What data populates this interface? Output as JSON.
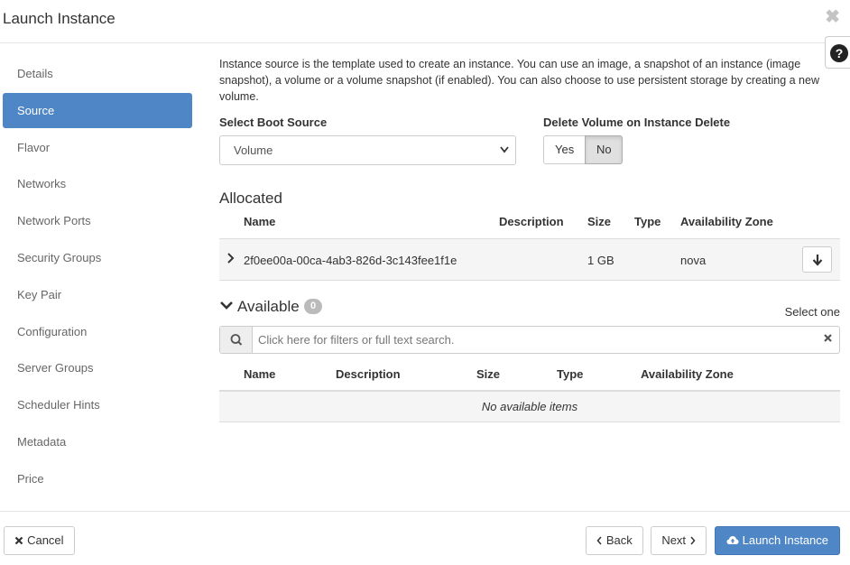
{
  "modal": {
    "title": "Launch Instance",
    "close_glyph": "✖",
    "help_glyph": "?"
  },
  "sidebar": {
    "items": [
      {
        "label": "Details"
      },
      {
        "label": "Source"
      },
      {
        "label": "Flavor"
      },
      {
        "label": "Networks"
      },
      {
        "label": "Network Ports"
      },
      {
        "label": "Security Groups"
      },
      {
        "label": "Key Pair"
      },
      {
        "label": "Configuration"
      },
      {
        "label": "Server Groups"
      },
      {
        "label": "Scheduler Hints"
      },
      {
        "label": "Metadata"
      },
      {
        "label": "Price"
      }
    ],
    "active": "Source"
  },
  "source": {
    "intro": "Instance source is the template used to create an instance. You can use an image, a snapshot of an instance (image snapshot), a volume or a volume snapshot (if enabled). You can also choose to use persistent storage by creating a new volume.",
    "boot_source_label": "Select Boot Source",
    "boot_source_value": "Volume",
    "delete_volume_label": "Delete Volume on Instance Delete",
    "delete_yes": "Yes",
    "delete_no": "No",
    "delete_selected": "No"
  },
  "allocated": {
    "title": "Allocated",
    "columns": {
      "name": "Name",
      "description": "Description",
      "size": "Size",
      "type": "Type",
      "zone": "Availability Zone"
    },
    "rows": [
      {
        "name": "2f0ee00a-00ca-4ab3-826d-3c143fee1f1e",
        "description": "",
        "size": "1 GB",
        "type": "",
        "zone": "nova"
      }
    ]
  },
  "available": {
    "title": "Available",
    "count": "0",
    "select_hint": "Select one",
    "search_placeholder": "Click here for filters or full text search.",
    "columns": {
      "name": "Name",
      "description": "Description",
      "size": "Size",
      "type": "Type",
      "zone": "Availability Zone"
    },
    "empty_text": "No available items"
  },
  "footer": {
    "cancel": "Cancel",
    "back": "Back",
    "next": "Next",
    "launch": "Launch Instance"
  },
  "colors": {
    "accent": "#4f86c5",
    "row_bg": "#f5f5f5"
  }
}
